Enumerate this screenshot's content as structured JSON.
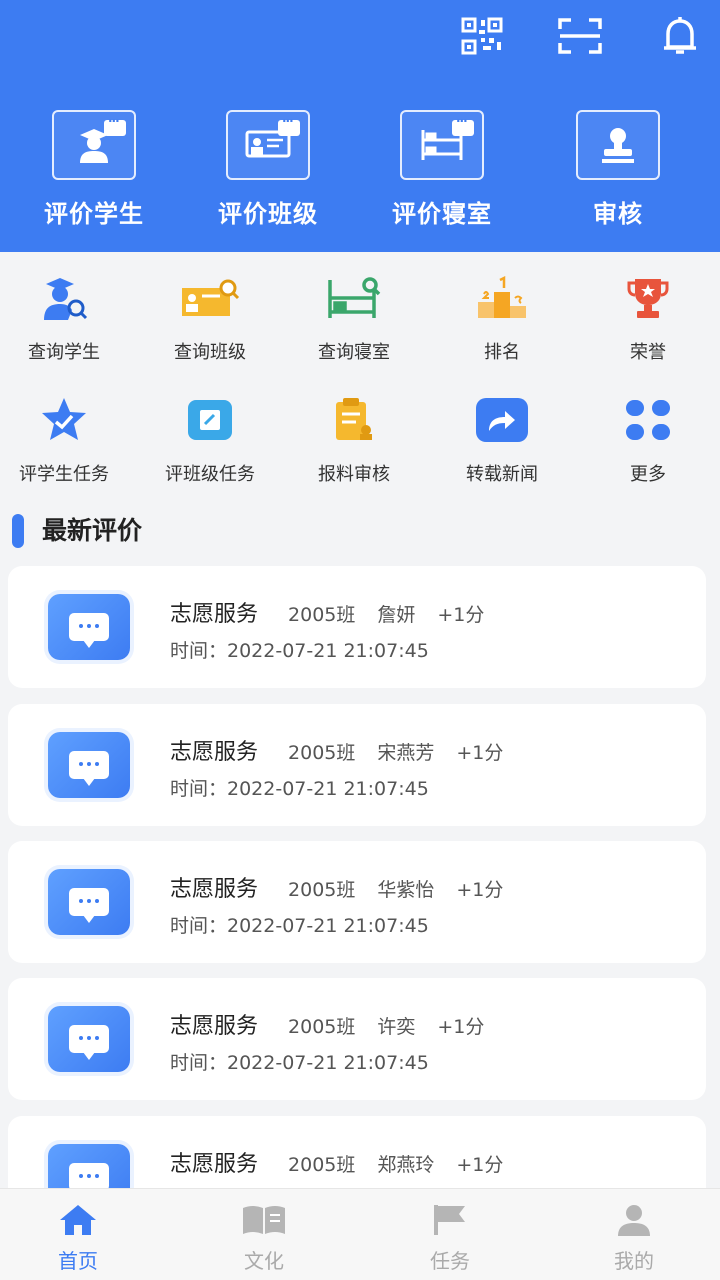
{
  "header": {
    "top_icons": [
      "qrcode-icon",
      "scan-icon",
      "bell-icon"
    ],
    "items": [
      {
        "label": "评价学生",
        "icon": "evaluate-student-icon"
      },
      {
        "label": "评价班级",
        "icon": "evaluate-class-icon"
      },
      {
        "label": "评价寝室",
        "icon": "evaluate-dorm-icon"
      },
      {
        "label": "审核",
        "icon": "review-stamp-icon"
      }
    ]
  },
  "functions": [
    {
      "label": "查询学生",
      "icon": "search-student-icon",
      "color": "#3d7cf2"
    },
    {
      "label": "查询班级",
      "icon": "search-class-icon",
      "color": "#f5b82e"
    },
    {
      "label": "查询寝室",
      "icon": "search-dorm-icon",
      "color": "#3aa66b"
    },
    {
      "label": "排名",
      "icon": "podium-icon",
      "color": "#f5a623"
    },
    {
      "label": "荣誉",
      "icon": "trophy-icon",
      "color": "#e8543c"
    },
    {
      "label": "评学生任务",
      "icon": "star-badge-icon",
      "color": "#3d7cf2"
    },
    {
      "label": "评班级任务",
      "icon": "edit-task-icon",
      "color": "#3aa8e8"
    },
    {
      "label": "报料审核",
      "icon": "report-review-icon",
      "color": "#f5b82e"
    },
    {
      "label": "转载新闻",
      "icon": "share-icon",
      "color": "#3d7cf2"
    },
    {
      "label": "更多",
      "icon": "grid-more-icon",
      "color": "#3d7cf2"
    }
  ],
  "section": {
    "title": "最新评价"
  },
  "evaluations": [
    {
      "type": "志愿服务",
      "class": "2005班",
      "name": "詹妍",
      "score": "+1分",
      "time": "时间：2022-07-21 21:07:45"
    },
    {
      "type": "志愿服务",
      "class": "2005班",
      "name": "宋燕芳",
      "score": "+1分",
      "time": "时间：2022-07-21 21:07:45"
    },
    {
      "type": "志愿服务",
      "class": "2005班",
      "name": "华紫怡",
      "score": "+1分",
      "time": "时间：2022-07-21 21:07:45"
    },
    {
      "type": "志愿服务",
      "class": "2005班",
      "name": "许奕",
      "score": "+1分",
      "time": "时间：2022-07-21 21:07:45"
    },
    {
      "type": "志愿服务",
      "class": "2005班",
      "name": "郑燕玲",
      "score": "+1分",
      "time": ""
    }
  ],
  "bottom_nav": [
    {
      "label": "首页",
      "icon": "home-icon",
      "active": true
    },
    {
      "label": "文化",
      "icon": "book-icon",
      "active": false
    },
    {
      "label": "任务",
      "icon": "flag-icon",
      "active": false
    },
    {
      "label": "我的",
      "icon": "user-icon",
      "active": false
    }
  ],
  "colors": {
    "primary": "#3d7cf2",
    "background": "#f3f4f6",
    "inactive": "#aaaaaa"
  }
}
